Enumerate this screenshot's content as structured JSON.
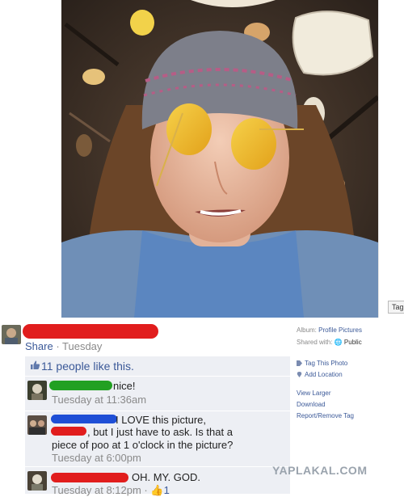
{
  "photo": {
    "tag_button": "Tag"
  },
  "post": {
    "share_label": "Share",
    "separator": " · ",
    "time": "Tuesday"
  },
  "likes": {
    "text": "11 people like this."
  },
  "comments": [
    {
      "text": "nice!",
      "time": "Tuesday at 11:36am"
    },
    {
      "line1": "I LOVE this picture,",
      "line2": ", but I just have to ask. Is that a",
      "line3": "piece of poo at 1 o'clock in the picture?",
      "time": "Tuesday at 6:00pm"
    },
    {
      "text": "OH. MY. GOD.",
      "time": "Tuesday at 8:12pm",
      "likes": "1"
    }
  ],
  "sidebar": {
    "album_label": "Album:",
    "album_value": "Profile Pictures",
    "shared_label": "Shared with:",
    "shared_value": "Public",
    "tag_photo": "Tag This Photo",
    "add_location": "Add Location",
    "view_larger": "View Larger",
    "download": "Download",
    "report": "Report/Remove Tag"
  },
  "watermark": "YAPLAKAL.COM",
  "colors": {
    "facebook_blue": "#3b5998",
    "comment_bg": "#edeff4",
    "redact_red": "#e11d1d",
    "redact_green": "#22a022",
    "redact_blue": "#1f4fd6"
  }
}
